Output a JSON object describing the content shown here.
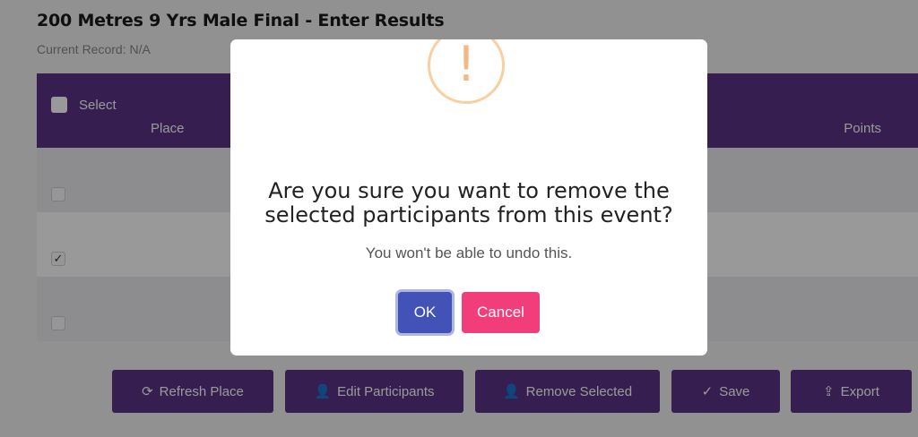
{
  "page": {
    "title": "200 Metres 9 Yrs Male Final - Enter Results",
    "current_record": "Current Record: N/A"
  },
  "table": {
    "header": {
      "select_label": "Select",
      "place_label": "Place",
      "points_label": "Points"
    },
    "rows": [
      {
        "checked": false,
        "mark": ""
      },
      {
        "checked": true,
        "mark": "✓"
      },
      {
        "checked": false,
        "mark": ""
      }
    ]
  },
  "actions": {
    "refresh": {
      "icon": "refresh-icon",
      "glyph": "⟳",
      "label": "Refresh Place"
    },
    "edit": {
      "icon": "user-edit-icon",
      "glyph": "👤",
      "label": "Edit Participants"
    },
    "remove": {
      "icon": "user-remove-icon",
      "glyph": "👤",
      "label": "Remove Selected"
    },
    "save": {
      "icon": "checkmark-icon",
      "glyph": "✓",
      "label": "Save"
    },
    "export": {
      "icon": "upload-icon",
      "glyph": "⇪",
      "label": "Export"
    }
  },
  "modal": {
    "icon": "warning-icon",
    "glyph": "!",
    "title": "Are you sure you want to remove the selected participants from this event?",
    "text": "You won't be able to undo this.",
    "ok_label": "OK",
    "cancel_label": "Cancel"
  },
  "colors": {
    "brand_purple": "#5a3585",
    "ok_blue": "#4352b7",
    "cancel_pink": "#f23d7b",
    "warning_orange": "#f8cfa0"
  }
}
